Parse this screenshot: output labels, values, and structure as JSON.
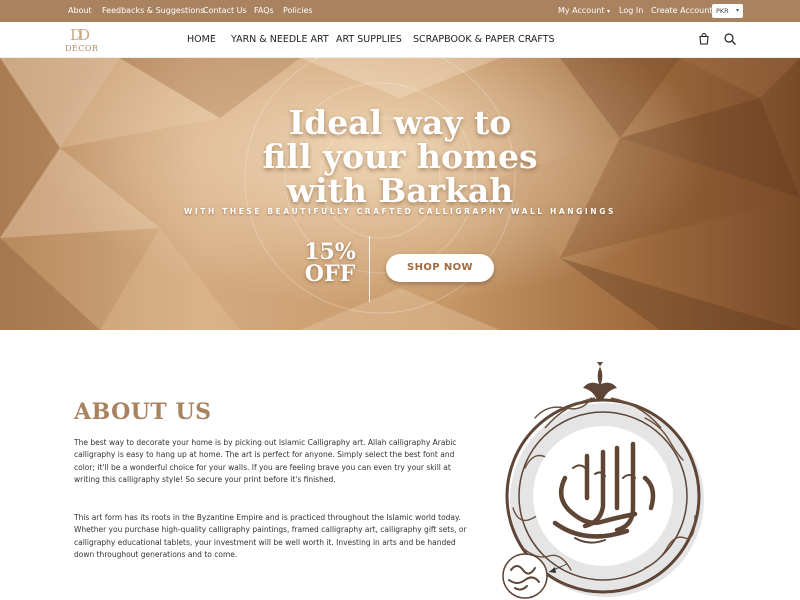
{
  "topbar": {
    "links": [
      "About",
      "Feedbacks & Suggestions",
      "Contact Us",
      "FAQs",
      "Policies"
    ],
    "my_account": "My Account",
    "login": "Log In",
    "create_account": "Create Account",
    "currency": "PKR"
  },
  "brand": {
    "logo_mark": "DD",
    "logo_word": "DÉCOR"
  },
  "nav": {
    "items": [
      "HOME",
      "YARN & NEEDLE ART",
      "ART SUPPLIES",
      "SCRAPBOOK & PAPER CRAFTS"
    ],
    "cart_icon": "cart-icon",
    "search_icon": "search-icon"
  },
  "hero": {
    "title_lines": [
      "Ideal way to",
      "fill your homes",
      "with Barkah"
    ],
    "subtitle": "WITH THESE BEAUTIFULLY CRAFTED CALLIGRAPHY WALL HANGINGS",
    "discount_pct": "15%",
    "discount_off": "OFF",
    "button": "SHOP NOW"
  },
  "about": {
    "title": "ABOUT US",
    "paragraphs": [
      "The best way to decorate your home is by picking out Islamic Calligraphy art. Allah calligraphy Arabic calligraphy is easy to hang up at home. The art is perfect for anyone. Simply select the best font and color; it'll be a wonderful choice for your walls. If you are feeling brave you can even try your skill at writing this calligraphy style! So secure your print before it's finished.",
      "This art form has its roots in the Byzantine Empire and is practiced throughout the Islamic world today. Whether you purchase high-quality calligraphy paintings, framed calligraphy art, calligraphy gift sets, or calligraphy educational tablets, your investment will be well worth it. Investing in arts and be handed down throughout generations and to come."
    ]
  },
  "colors": {
    "brand": "#a9825f",
    "button_text": "#a06a40",
    "art_wood": "#5e4536"
  }
}
